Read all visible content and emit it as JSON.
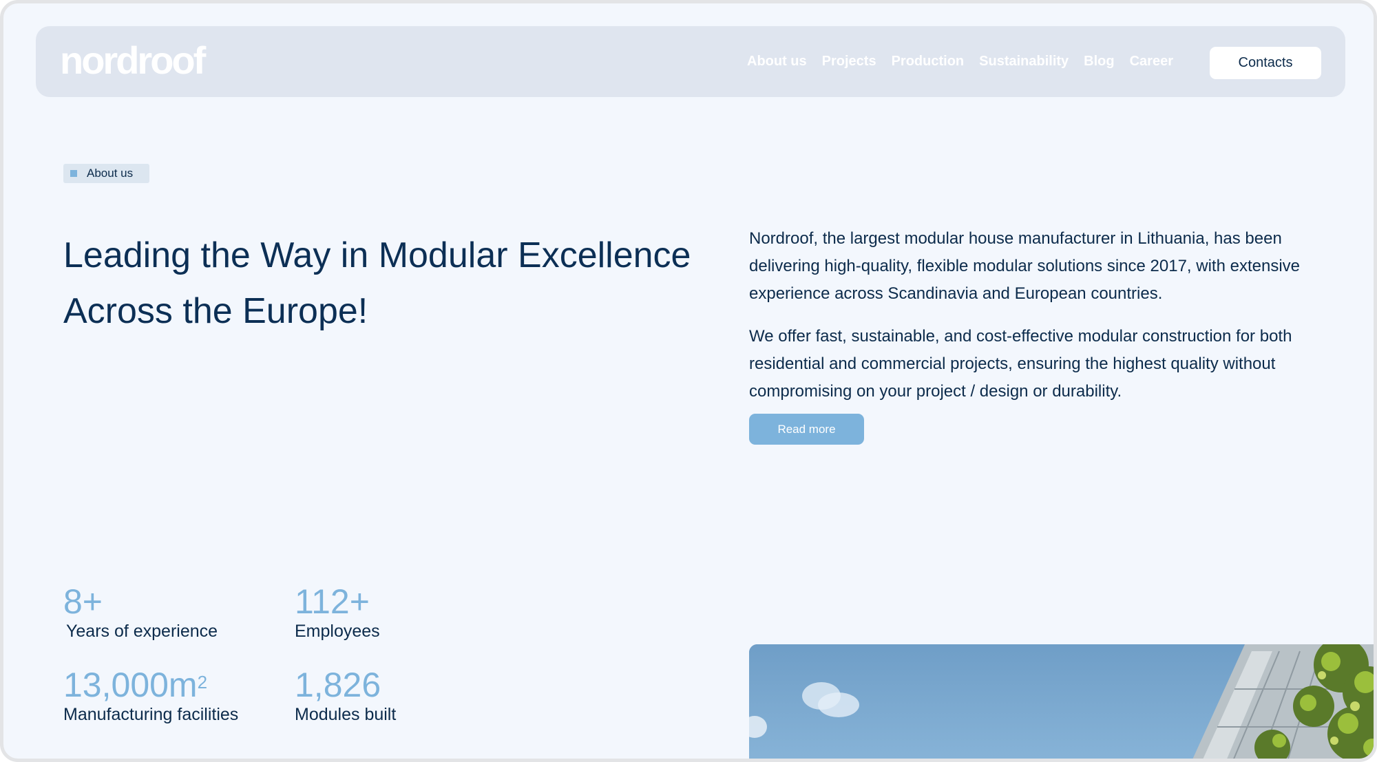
{
  "header": {
    "logo": "nordroof",
    "nav": [
      "About us",
      "Projects",
      "Production",
      "Sustainability",
      "Blog",
      "Career"
    ],
    "contacts_label": "Contacts"
  },
  "section_tag": "About us",
  "heading": "Leading the Way in Modular Excellence Across the Europe!",
  "description": {
    "paragraph1": "Nordroof, the largest modular house manufacturer in Lithuania, has been delivering high-quality, flexible modular solutions since 2017, with extensive experience across Scandinavia and European countries.",
    "paragraph2": "We offer fast, sustainable, and cost-effective modular construction for both residential and commercial projects, ensuring the highest quality without compromising on your project / design or durability.",
    "read_more_label": "Read more"
  },
  "stats": [
    {
      "value": "8+",
      "label": "Years of experience"
    },
    {
      "value": "112+",
      "label": "Employees"
    },
    {
      "value": "13,000m",
      "value_sup": "2",
      "label": "Manufacturing facilities"
    },
    {
      "value": "1,826",
      "label": "Modules built"
    }
  ],
  "colors": {
    "page_background": "#f3f7fd",
    "header_background": "#dfe5ef",
    "accent": "#7db3dc",
    "text_dark": "#0c2b4b"
  }
}
